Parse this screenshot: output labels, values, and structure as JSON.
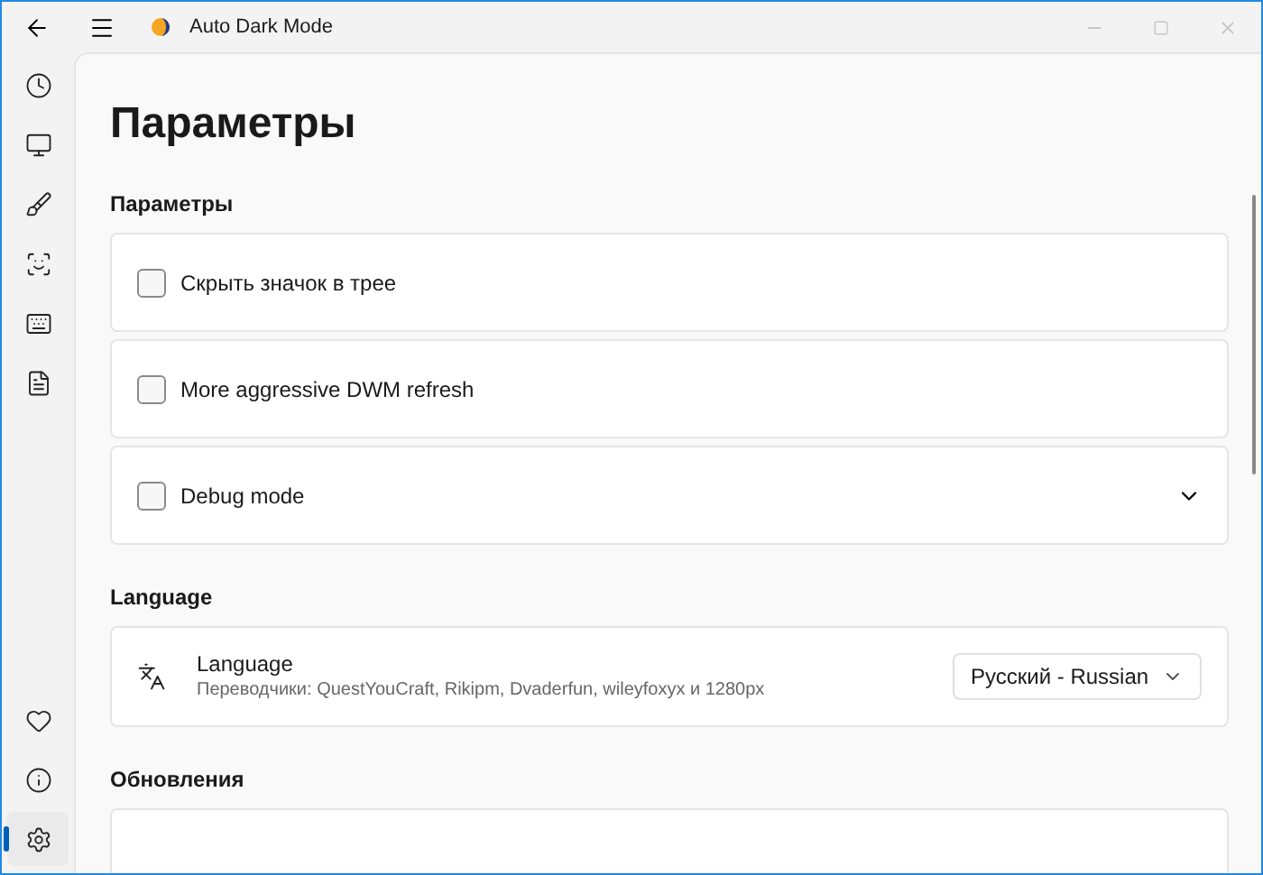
{
  "window": {
    "title": "Auto Dark Mode"
  },
  "nav": {
    "top": [
      {
        "kind": "clock",
        "selected": false
      },
      {
        "kind": "monitor",
        "selected": false
      },
      {
        "kind": "brush",
        "selected": false
      },
      {
        "kind": "scan",
        "selected": false
      },
      {
        "kind": "keyboard",
        "selected": false
      },
      {
        "kind": "file",
        "selected": false
      }
    ],
    "bottom": [
      {
        "kind": "heart",
        "selected": false
      },
      {
        "kind": "info",
        "selected": false
      },
      {
        "kind": "settings",
        "selected": true
      }
    ]
  },
  "page_title": "Параметры",
  "sections": [
    {
      "title": "Параметры",
      "items": [
        {
          "kind": "checkbox",
          "label": "Скрыть значок в трее",
          "checked": false
        },
        {
          "kind": "checkbox",
          "label": "More aggressive DWM refresh",
          "checked": false
        },
        {
          "kind": "checkbox",
          "label": "Debug mode",
          "checked": false,
          "expanded": false
        }
      ]
    },
    {
      "title": "Language",
      "items": [
        {
          "kind": "select",
          "label": "Language",
          "description": "Переводчики: QuestYouCraft, Rikipm, Dvaderfun, wileyfoxyx и 1280px",
          "value": "Русский - Russian"
        }
      ]
    },
    {
      "title": "Обновления",
      "items": [
        {
          "kind": "empty"
        }
      ]
    }
  ]
}
